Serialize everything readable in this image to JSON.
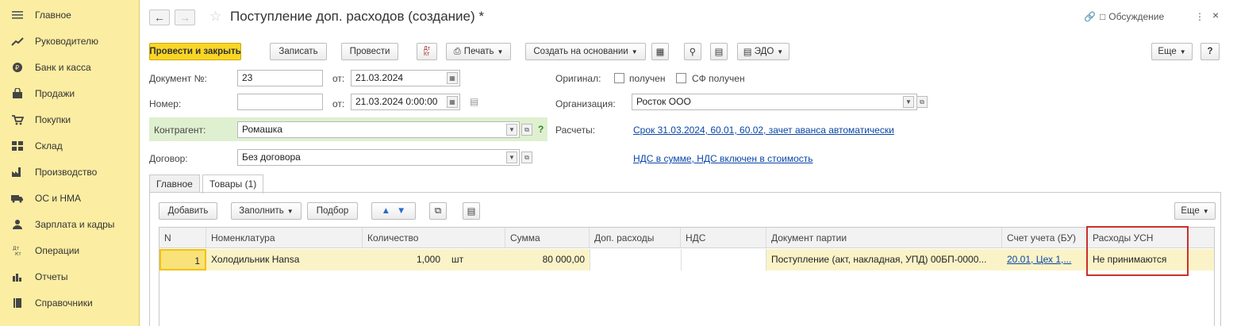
{
  "sidebar": {
    "items": [
      {
        "label": "Главное",
        "icon": "menu-lines-icon"
      },
      {
        "label": "Руководителю",
        "icon": "trend-icon"
      },
      {
        "label": "Банк и касса",
        "icon": "coin-icon"
      },
      {
        "label": "Продажи",
        "icon": "bag-icon"
      },
      {
        "label": "Покупки",
        "icon": "cart-icon"
      },
      {
        "label": "Склад",
        "icon": "warehouse-icon"
      },
      {
        "label": "Производство",
        "icon": "factory-icon"
      },
      {
        "label": "ОС и НМА",
        "icon": "truck-icon"
      },
      {
        "label": "Зарплата и кадры",
        "icon": "person-icon"
      },
      {
        "label": "Операции",
        "icon": "dt-kt-icon"
      },
      {
        "label": "Отчеты",
        "icon": "bar-chart-icon"
      },
      {
        "label": "Справочники",
        "icon": "book-icon"
      }
    ]
  },
  "header": {
    "title": "Поступление доп. расходов (создание) *",
    "discussion": "Обсуждение"
  },
  "toolbar": {
    "post_close": "Провести и закрыть",
    "save": "Записать",
    "post": "Провести",
    "print": "Печать",
    "create_basis": "Создать на основании",
    "edo": "ЭДО",
    "more": "Еще",
    "help": "?"
  },
  "form": {
    "doc_no_label": "Документ №:",
    "doc_no": "23",
    "from_label": "от:",
    "doc_date": "21.03.2024",
    "number_label": "Номер:",
    "number_value": "",
    "number_date": "21.03.2024  0:00:00",
    "original_label": "Оригинал:",
    "received_label": "получен",
    "sf_received_label": "СФ получен",
    "org_label": "Организация:",
    "org_value": "Росток ООО",
    "counterparty_label": "Контрагент:",
    "counterparty_value": "Ромашка",
    "settlements_label": "Расчеты:",
    "settlements_link": "Срок 31.03.2024, 60.01, 60.02, зачет аванса автоматически",
    "contract_label": "Договор:",
    "contract_value": "Без договора",
    "vat_link": "НДС в сумме, НДС включен в стоимость"
  },
  "tabs": [
    {
      "label": "Главное"
    },
    {
      "label": "Товары (1)"
    }
  ],
  "goods_toolbar": {
    "add": "Добавить",
    "fill": "Заполнить",
    "pick": "Подбор",
    "more": "Еще"
  },
  "table": {
    "columns": [
      "N",
      "Номенклатура",
      "Количество",
      "Сумма",
      "Доп. расходы",
      "НДС",
      "Документ партии",
      "Счет учета (БУ)",
      "Расходы УСН"
    ],
    "rows": [
      {
        "n": "1",
        "item": "Холодильник Hansa",
        "qty": "1,000",
        "unit": "шт",
        "sum": "80 000,00",
        "extra": "",
        "vat": "",
        "batch_doc": "Поступление (акт, накладная, УПД) 00БП-0000...",
        "account": "20.01, Цех 1,...",
        "usn": "Не принимаются"
      }
    ]
  }
}
